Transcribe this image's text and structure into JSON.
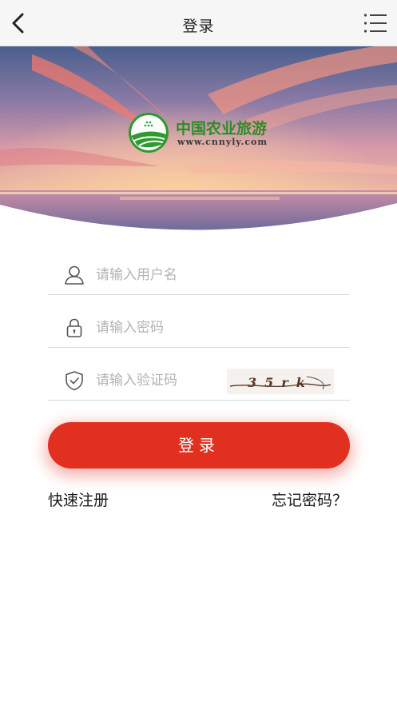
{
  "header": {
    "title": "登录"
  },
  "banner": {
    "logo_name": "中国农业旅游",
    "logo_url": "www.cnnyly.com"
  },
  "form": {
    "username_placeholder": "请输入用户名",
    "password_placeholder": "请输入密码",
    "captcha_placeholder": "请输入验证码",
    "captcha_text": "35rk",
    "login_label": "登录"
  },
  "links": {
    "register": "快速注册",
    "forgot_password": "忘记密码？"
  },
  "icons": {
    "back": "chevron-left-icon",
    "menu": "list-menu-icon",
    "username": "user-icon",
    "password": "lock-icon",
    "captcha": "shield-check-icon"
  },
  "colors": {
    "accent": "#e23020",
    "logo_green": "#2e8b2a"
  }
}
